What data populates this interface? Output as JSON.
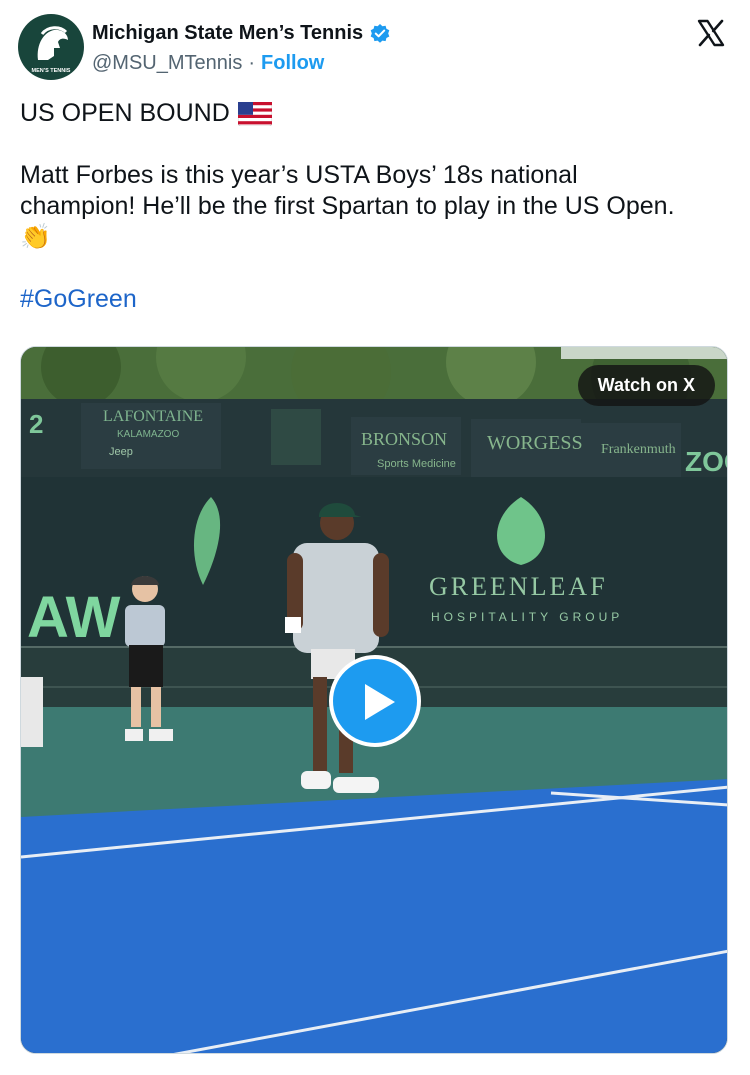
{
  "account": {
    "display_name": "Michigan State Men’s Tennis",
    "handle": "@MSU_MTennis",
    "separator": "·",
    "follow_label": "Follow",
    "avatar_text": "MEN'S TENNIS"
  },
  "tweet": {
    "line1": "US OPEN BOUND",
    "line2": "Matt Forbes is this year’s USTA Boys’ 18s national",
    "line3": "champion! He’ll be the first Spartan to play in the US Open.",
    "emoji": "👏",
    "hashtag": "#GoGreen"
  },
  "media": {
    "watch_label": "Watch on X",
    "banners": [
      "LAFONTAINE",
      "KALAMAZOO",
      "Jeep",
      "BRONSON",
      "Sports Medicine",
      "WORGESS",
      "Frankenmuth",
      "ZOO",
      "GREENLEAF",
      "HOSPITALITY GROUP",
      "AW",
      "2"
    ]
  },
  "colors": {
    "accent": "#1d9bf0",
    "hashtag": "#1d65c9",
    "msu_green": "#18453b",
    "court_blue": "#2a6fcf",
    "court_green": "#3d7a72"
  }
}
